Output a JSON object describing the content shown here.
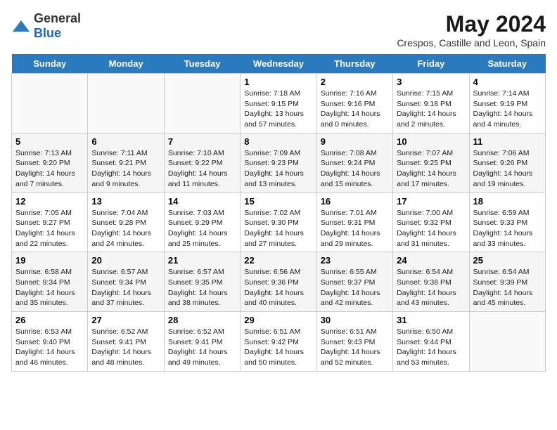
{
  "header": {
    "logo_general": "General",
    "logo_blue": "Blue",
    "title": "May 2024",
    "subtitle": "Crespos, Castille and Leon, Spain"
  },
  "days_of_week": [
    "Sunday",
    "Monday",
    "Tuesday",
    "Wednesday",
    "Thursday",
    "Friday",
    "Saturday"
  ],
  "weeks": [
    [
      {
        "day": "",
        "text": ""
      },
      {
        "day": "",
        "text": ""
      },
      {
        "day": "",
        "text": ""
      },
      {
        "day": "1",
        "text": "Sunrise: 7:18 AM\nSunset: 9:15 PM\nDaylight: 13 hours and 57 minutes."
      },
      {
        "day": "2",
        "text": "Sunrise: 7:16 AM\nSunset: 9:16 PM\nDaylight: 14 hours and 0 minutes."
      },
      {
        "day": "3",
        "text": "Sunrise: 7:15 AM\nSunset: 9:18 PM\nDaylight: 14 hours and 2 minutes."
      },
      {
        "day": "4",
        "text": "Sunrise: 7:14 AM\nSunset: 9:19 PM\nDaylight: 14 hours and 4 minutes."
      }
    ],
    [
      {
        "day": "5",
        "text": "Sunrise: 7:13 AM\nSunset: 9:20 PM\nDaylight: 14 hours and 7 minutes."
      },
      {
        "day": "6",
        "text": "Sunrise: 7:11 AM\nSunset: 9:21 PM\nDaylight: 14 hours and 9 minutes."
      },
      {
        "day": "7",
        "text": "Sunrise: 7:10 AM\nSunset: 9:22 PM\nDaylight: 14 hours and 11 minutes."
      },
      {
        "day": "8",
        "text": "Sunrise: 7:09 AM\nSunset: 9:23 PM\nDaylight: 14 hours and 13 minutes."
      },
      {
        "day": "9",
        "text": "Sunrise: 7:08 AM\nSunset: 9:24 PM\nDaylight: 14 hours and 15 minutes."
      },
      {
        "day": "10",
        "text": "Sunrise: 7:07 AM\nSunset: 9:25 PM\nDaylight: 14 hours and 17 minutes."
      },
      {
        "day": "11",
        "text": "Sunrise: 7:06 AM\nSunset: 9:26 PM\nDaylight: 14 hours and 19 minutes."
      }
    ],
    [
      {
        "day": "12",
        "text": "Sunrise: 7:05 AM\nSunset: 9:27 PM\nDaylight: 14 hours and 22 minutes."
      },
      {
        "day": "13",
        "text": "Sunrise: 7:04 AM\nSunset: 9:28 PM\nDaylight: 14 hours and 24 minutes."
      },
      {
        "day": "14",
        "text": "Sunrise: 7:03 AM\nSunset: 9:29 PM\nDaylight: 14 hours and 25 minutes."
      },
      {
        "day": "15",
        "text": "Sunrise: 7:02 AM\nSunset: 9:30 PM\nDaylight: 14 hours and 27 minutes."
      },
      {
        "day": "16",
        "text": "Sunrise: 7:01 AM\nSunset: 9:31 PM\nDaylight: 14 hours and 29 minutes."
      },
      {
        "day": "17",
        "text": "Sunrise: 7:00 AM\nSunset: 9:32 PM\nDaylight: 14 hours and 31 minutes."
      },
      {
        "day": "18",
        "text": "Sunrise: 6:59 AM\nSunset: 9:33 PM\nDaylight: 14 hours and 33 minutes."
      }
    ],
    [
      {
        "day": "19",
        "text": "Sunrise: 6:58 AM\nSunset: 9:34 PM\nDaylight: 14 hours and 35 minutes."
      },
      {
        "day": "20",
        "text": "Sunrise: 6:57 AM\nSunset: 9:34 PM\nDaylight: 14 hours and 37 minutes."
      },
      {
        "day": "21",
        "text": "Sunrise: 6:57 AM\nSunset: 9:35 PM\nDaylight: 14 hours and 38 minutes."
      },
      {
        "day": "22",
        "text": "Sunrise: 6:56 AM\nSunset: 9:36 PM\nDaylight: 14 hours and 40 minutes."
      },
      {
        "day": "23",
        "text": "Sunrise: 6:55 AM\nSunset: 9:37 PM\nDaylight: 14 hours and 42 minutes."
      },
      {
        "day": "24",
        "text": "Sunrise: 6:54 AM\nSunset: 9:38 PM\nDaylight: 14 hours and 43 minutes."
      },
      {
        "day": "25",
        "text": "Sunrise: 6:54 AM\nSunset: 9:39 PM\nDaylight: 14 hours and 45 minutes."
      }
    ],
    [
      {
        "day": "26",
        "text": "Sunrise: 6:53 AM\nSunset: 9:40 PM\nDaylight: 14 hours and 46 minutes."
      },
      {
        "day": "27",
        "text": "Sunrise: 6:52 AM\nSunset: 9:41 PM\nDaylight: 14 hours and 48 minutes."
      },
      {
        "day": "28",
        "text": "Sunrise: 6:52 AM\nSunset: 9:41 PM\nDaylight: 14 hours and 49 minutes."
      },
      {
        "day": "29",
        "text": "Sunrise: 6:51 AM\nSunset: 9:42 PM\nDaylight: 14 hours and 50 minutes."
      },
      {
        "day": "30",
        "text": "Sunrise: 6:51 AM\nSunset: 9:43 PM\nDaylight: 14 hours and 52 minutes."
      },
      {
        "day": "31",
        "text": "Sunrise: 6:50 AM\nSunset: 9:44 PM\nDaylight: 14 hours and 53 minutes."
      },
      {
        "day": "",
        "text": ""
      }
    ]
  ]
}
